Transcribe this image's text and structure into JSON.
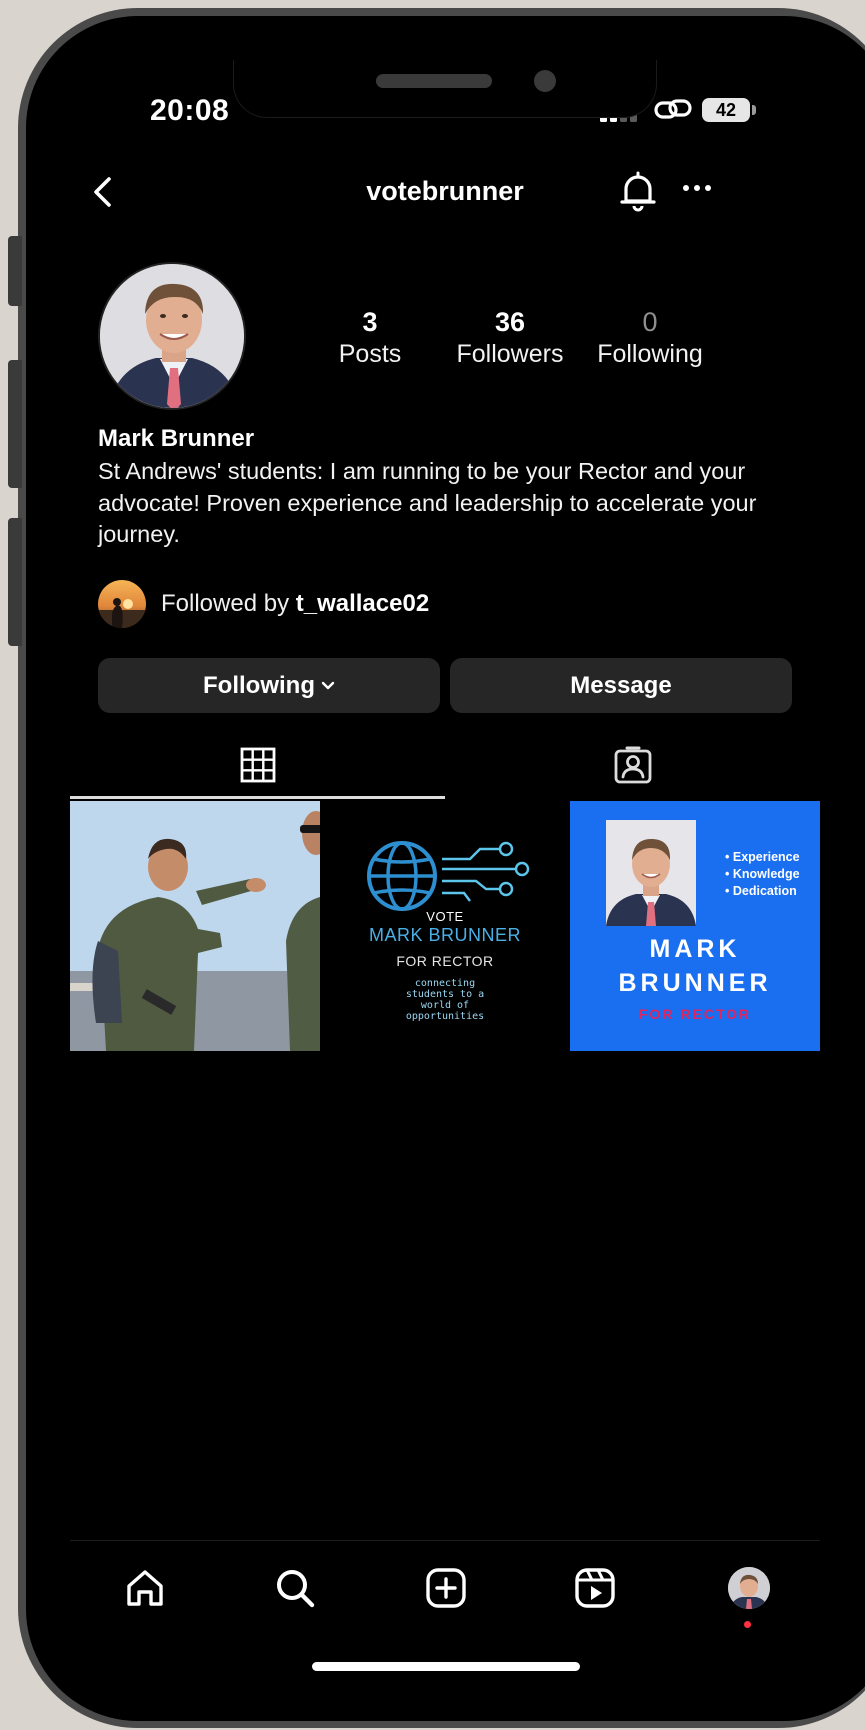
{
  "status_bar": {
    "time": "20:08",
    "battery": "42"
  },
  "header": {
    "username": "votebrunner"
  },
  "profile": {
    "stats": [
      {
        "value": "3",
        "label": "Posts"
      },
      {
        "value": "36",
        "label": "Followers"
      },
      {
        "value": "0",
        "label": "Following"
      }
    ],
    "display_name": "Mark Brunner",
    "bio": "St Andrews' students: I am running to be your Rector and your advocate! Proven experience and leadership to accelerate your journey.",
    "followed_by_prefix": "Followed by",
    "followed_by_user": "t_wallace02"
  },
  "actions": {
    "following_label": "Following",
    "message_label": "Message"
  },
  "posts": {
    "post2": {
      "vote": "VOTE",
      "name": "MARK BRUNNER",
      "for_rector": "FOR RECTOR",
      "tagline": "connecting students to a world of opportunities"
    },
    "post3": {
      "bullets": [
        "Experience",
        "Knowledge",
        "Dedication"
      ],
      "first_name": "MARK",
      "last_name": "BRUNNER",
      "for_rector": "FOR RECTOR"
    }
  },
  "colors": {
    "background": "#000000",
    "button": "#262626",
    "accent_blue": "#1a6ef0",
    "notification_dot": "#ff3040"
  },
  "icons": {
    "back": "chevron-left-icon",
    "bell": "bell-icon",
    "more": "more-horizontal-icon",
    "grid": "grid-icon",
    "tagged": "tagged-person-icon",
    "home": "home-icon",
    "search": "search-icon",
    "create": "plus-square-icon",
    "reels": "reels-icon"
  }
}
